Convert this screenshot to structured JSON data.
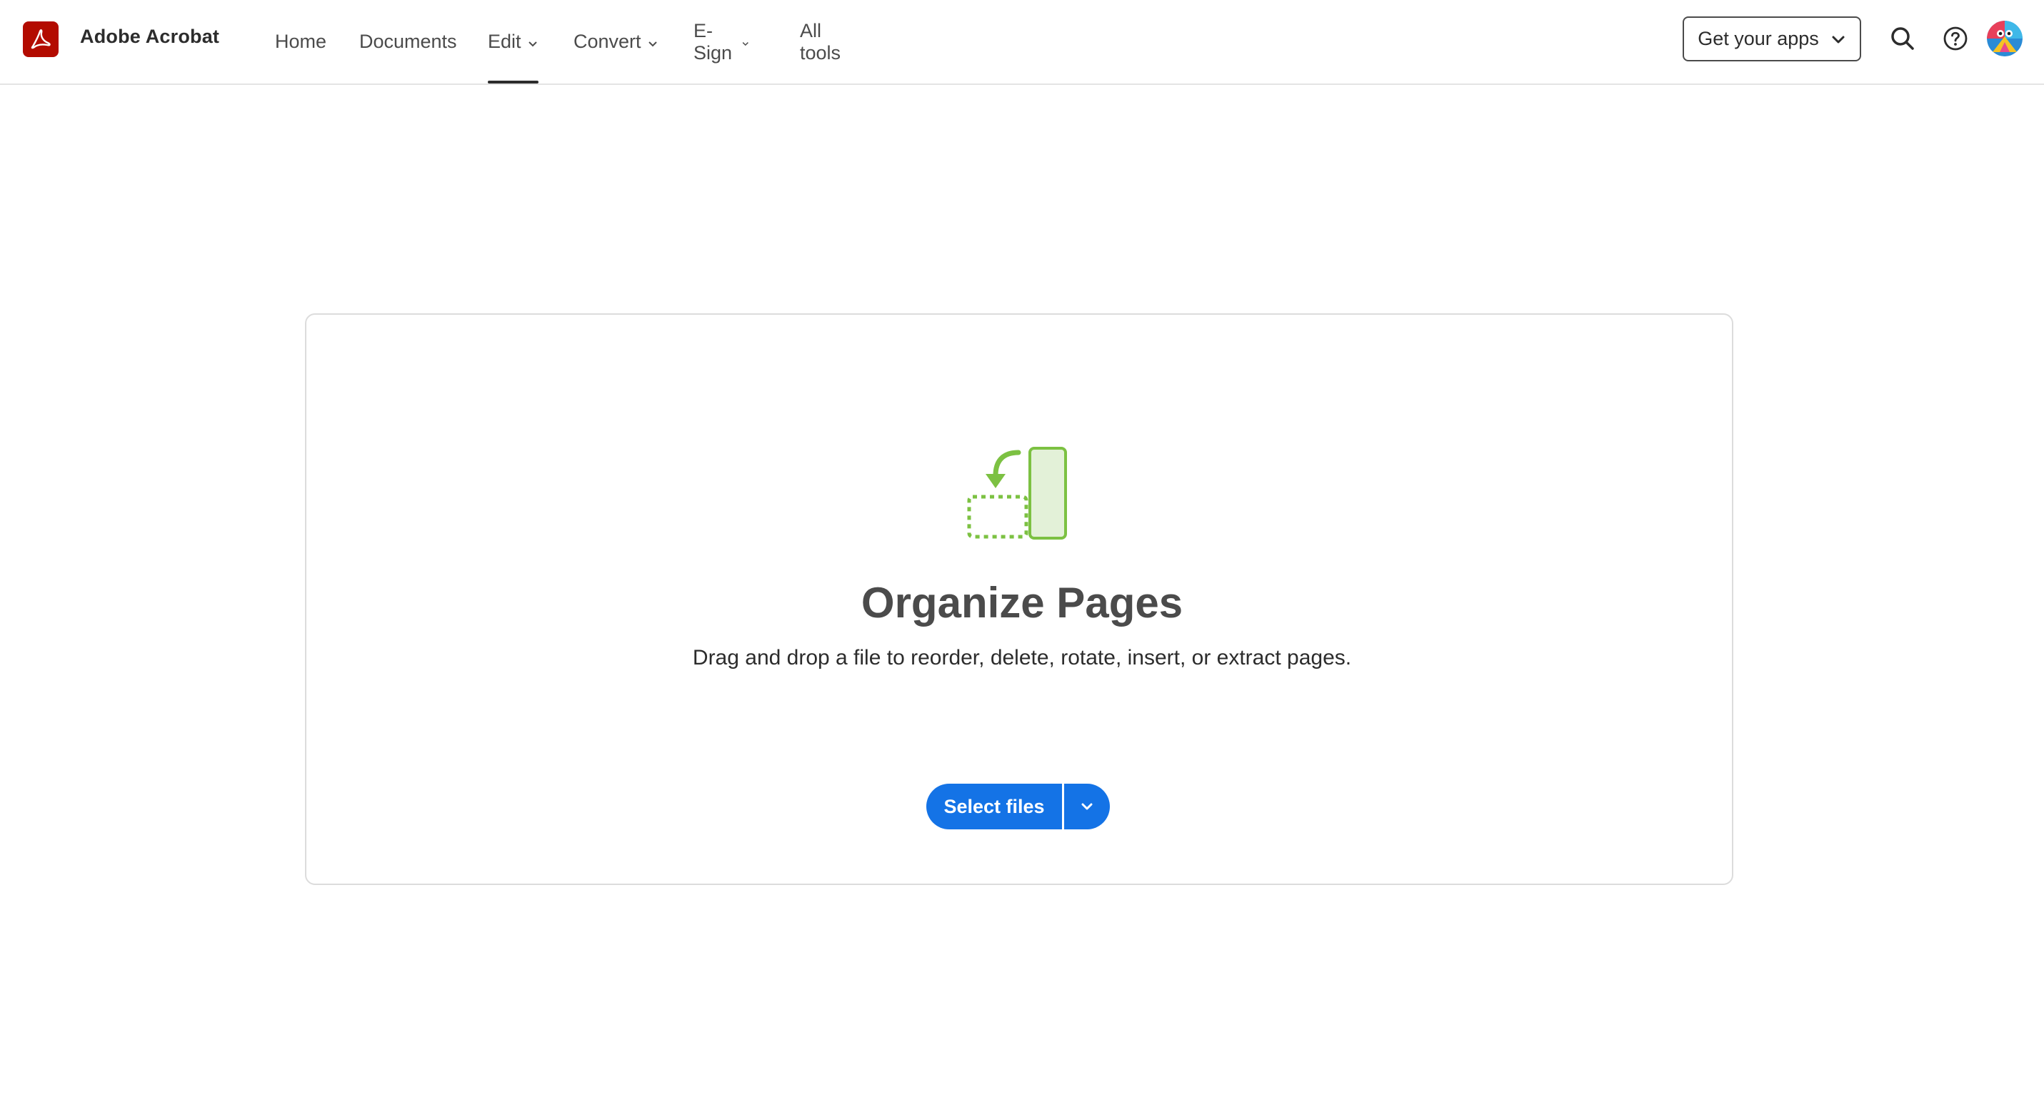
{
  "header": {
    "app_title": "Adobe Acrobat",
    "nav": [
      {
        "label": "Home",
        "has_dropdown": false,
        "active": false
      },
      {
        "label": "Documents",
        "has_dropdown": false,
        "active": false
      },
      {
        "label": "Edit",
        "has_dropdown": true,
        "active": true
      },
      {
        "label": "Convert",
        "has_dropdown": true,
        "active": false
      },
      {
        "label": "E-Sign",
        "has_dropdown": true,
        "active": false
      },
      {
        "label": "All tools",
        "has_dropdown": false,
        "active": false
      }
    ],
    "get_apps_label": "Get your apps",
    "icons": [
      "acrobat-logo-icon",
      "search-icon",
      "help-icon",
      "avatar"
    ]
  },
  "main": {
    "tool_icon": "organize-pages-icon",
    "title": "Organize Pages",
    "description": "Drag and drop a file to reorder, delete, rotate, insert, or extract pages.",
    "select_files_label": "Select files"
  },
  "colors": {
    "brand_red": "#b30b00",
    "primary_blue": "#1473e6",
    "illustration_green": "#7cc142"
  }
}
